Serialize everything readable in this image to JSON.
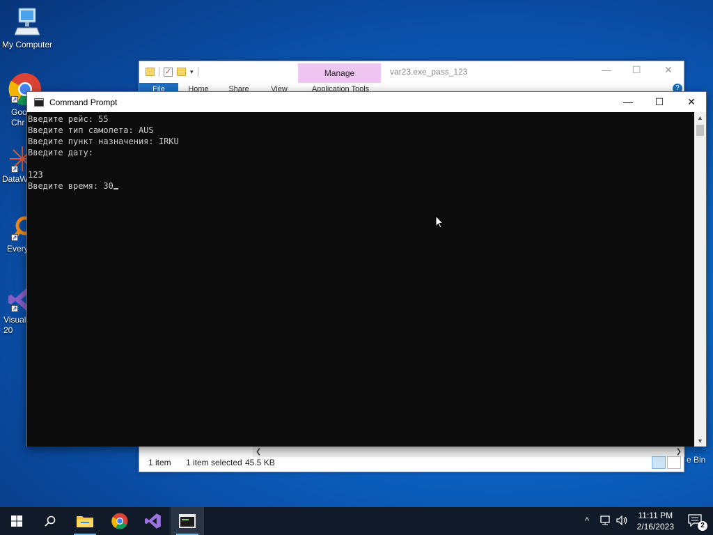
{
  "desktop": {
    "icons": [
      {
        "label": "My Computer",
        "icon": "computer-icon"
      },
      {
        "label": "Goo\nChr",
        "icon": "chrome-icon"
      },
      {
        "label": "DataW",
        "icon": "datawarrior-icon"
      },
      {
        "label": "Every",
        "icon": "everything-icon"
      },
      {
        "label": "Visual\n20",
        "icon": "visual-studio-icon"
      }
    ],
    "recycle_bin_label": "e Bin"
  },
  "explorer": {
    "manage_label": "Manage",
    "title": "var23.exe_pass_123",
    "tabs": [
      "File",
      "Home",
      "Share",
      "View",
      "Application Tools"
    ],
    "help_label": "?",
    "status": {
      "items": "1 item",
      "selected": "1 item selected",
      "size": "45.5 KB"
    }
  },
  "cmd": {
    "title": "Command Prompt",
    "lines": [
      "Введите рейс: 55",
      "Введите тип самолета: AUS",
      "Введите пункт назначения: IRKU",
      "Введите дату:",
      "",
      "123",
      "Введите время: 30"
    ]
  },
  "taskbar": {
    "apps": [
      "start-icon",
      "search-icon",
      "file-explorer-icon",
      "chrome-icon",
      "visual-studio-icon",
      "command-prompt-icon"
    ],
    "clock_time": "11:11 PM",
    "clock_date": "2/16/2023",
    "notification_count": "2"
  },
  "colors": {
    "console_bg": "#0c0c0c",
    "console_fg": "#cccccc",
    "manage_tab": "#efc6f2",
    "file_tab": "#1a6ec0",
    "taskbar": "#101a28"
  }
}
